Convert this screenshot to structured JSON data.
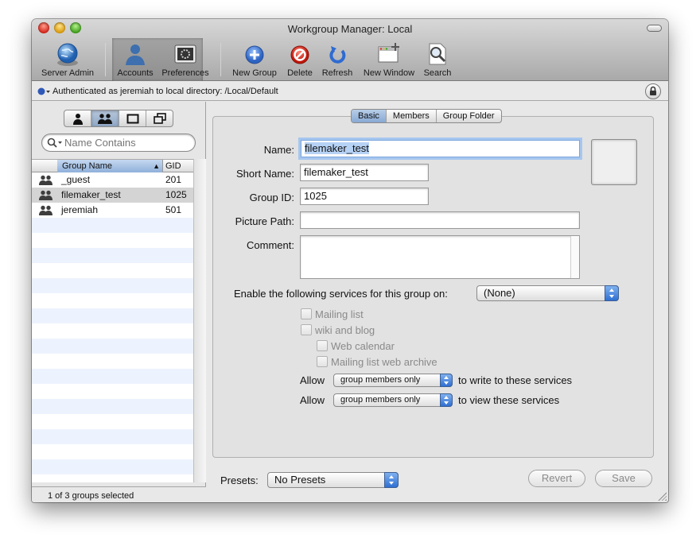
{
  "window": {
    "title": "Workgroup Manager: Local"
  },
  "toolbar": {
    "server_admin": "Server Admin",
    "accounts": "Accounts",
    "preferences": "Preferences",
    "new_group": "New Group",
    "delete": "Delete",
    "refresh": "Refresh",
    "new_window": "New Window",
    "search": "Search"
  },
  "auth": {
    "text": "Authenticated as jeremiah to local directory: /Local/Default"
  },
  "sidebar": {
    "search_placeholder": "Name Contains",
    "col_name": "Group Name",
    "col_gid": "GID",
    "rows": [
      {
        "name": "_guest",
        "gid": "201"
      },
      {
        "name": "filemaker_test",
        "gid": "1025"
      },
      {
        "name": "jeremiah",
        "gid": "501"
      }
    ],
    "selected_index": 1,
    "status": "1 of 3 groups selected"
  },
  "tabs": {
    "basic": "Basic",
    "members": "Members",
    "group_folder": "Group Folder",
    "active": "Basic"
  },
  "form": {
    "name_label": "Name:",
    "name_value": "filemaker_test",
    "short_name_label": "Short Name:",
    "short_name_value": "filemaker_test",
    "group_id_label": "Group ID:",
    "group_id_value": "1025",
    "picture_path_label": "Picture Path:",
    "picture_path_value": "",
    "comment_label": "Comment:",
    "comment_value": "",
    "services_label": "Enable the following services for this group on:",
    "services_value": "(None)",
    "mailing_list": "Mailing list",
    "wiki_blog": "wiki and blog",
    "web_calendar": "Web calendar",
    "mailing_archive": "Mailing list web archive",
    "allow": "Allow",
    "write_value": "group members only",
    "write_suffix": "to write to these services",
    "view_value": "group members only",
    "view_suffix": "to view these services"
  },
  "footer": {
    "presets_label": "Presets:",
    "presets_value": "No Presets",
    "revert": "Revert",
    "save": "Save"
  }
}
